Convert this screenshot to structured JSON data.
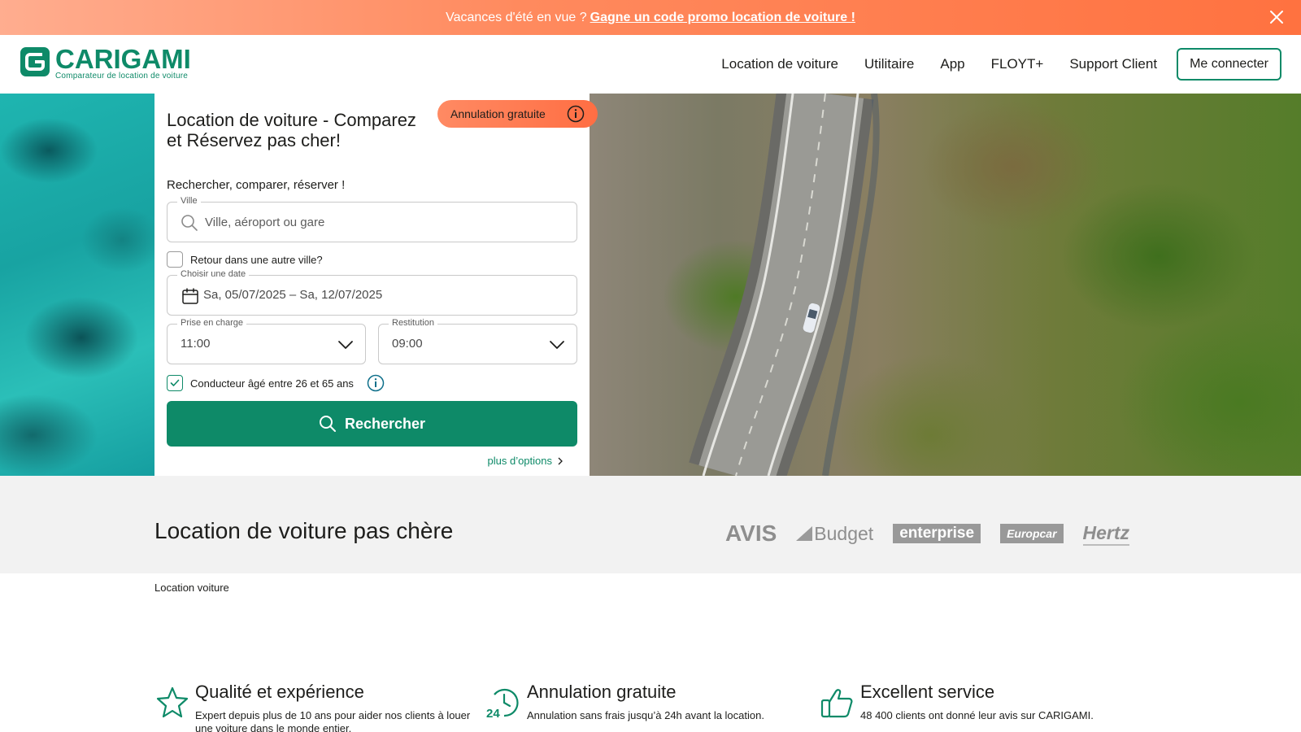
{
  "promo": {
    "text": "Vacances d'été en vue ?",
    "link": "Gagne un code promo location de voiture !"
  },
  "brand": {
    "name": "CARIGAMI",
    "tagline": "Comparateur de location de voiture",
    "accent_color": "#0e8a68",
    "promo_color": "#ff7a4c"
  },
  "nav": {
    "items": [
      "Location de voiture",
      "Utilitaire",
      "App",
      "FLOYT+",
      "Support Client"
    ],
    "login": "Me connecter"
  },
  "search": {
    "title": "Location de voiture - Comparez et Réservez pas cher!",
    "badge": "Annulation gratuite",
    "subtitle": "Rechercher, comparer, réserver !",
    "city_label": "Ville",
    "city_placeholder": "Ville, aéroport ou gare",
    "return_label": "Retour dans une autre ville?",
    "return_checked": false,
    "date_label": "Choisir une date",
    "date_value": "Sa, 05/07/2025 – Sa, 12/07/2025",
    "pickup_label": "Prise en charge",
    "pickup_time": "11:00",
    "return_time_label": "Restitution",
    "return_time": "09:00",
    "driver_label": "Conducteur âgé entre 26 et 65 ans",
    "driver_checked": true,
    "button": "Rechercher",
    "more_options": "plus d’options"
  },
  "brands_strip": {
    "title": "Location de voiture pas chère",
    "logos": [
      "AVIS",
      "Budget",
      "enterprise",
      "Europcar",
      "Hertz"
    ]
  },
  "breadcrumb": "Location voiture",
  "features": [
    {
      "icon": "star-icon",
      "title": "Qualité et expérience",
      "desc": "Expert depuis plus de 10 ans pour aider nos clients à louer une voiture dans le monde entier."
    },
    {
      "icon": "clock-24-icon",
      "title": "Annulation gratuite",
      "desc": "Annulation sans frais jusqu’à 24h avant la location."
    },
    {
      "icon": "thumbs-up-icon",
      "title": "Excellent service",
      "desc": "48 400 clients ont donné leur avis sur CARIGAMI."
    }
  ]
}
